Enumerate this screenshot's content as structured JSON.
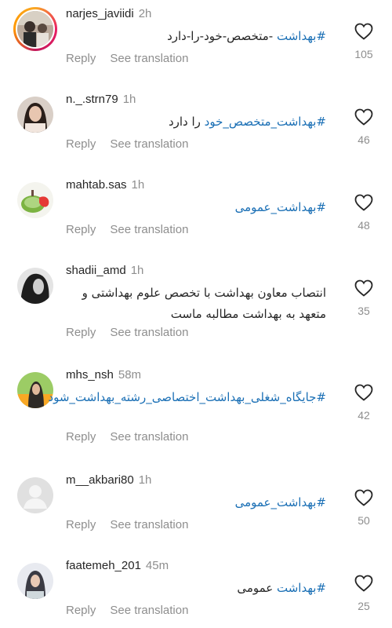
{
  "comments": [
    {
      "username": "narjes_javiidi",
      "time": "2h",
      "hashtag": "#بهداشت",
      "text": " -متخصص-خود-را-دارد",
      "reply": "Reply",
      "see_translation": "See translation",
      "likes": "105"
    },
    {
      "username": "n._.strn79",
      "time": "1h",
      "hashtag": "#بهداشت_متخصص_خود",
      "text": " را دارد",
      "reply": "Reply",
      "see_translation": "See translation",
      "likes": "46"
    },
    {
      "username": "mahtab.sas",
      "time": "1h",
      "hashtag": "#بهداشت_عمومی",
      "text": "",
      "reply": "Reply",
      "see_translation": "See translation",
      "likes": "48"
    },
    {
      "username": "shadii_amd",
      "time": "1h",
      "hashtag": "",
      "text": "انتصاب معاون بهداشت با تخصص علوم بهداشتی و متعهد به بهداشت مطالبه ماست",
      "reply": "Reply",
      "see_translation": "See translation",
      "likes": "35"
    },
    {
      "username": "mhs_nsh",
      "time": "58m",
      "hashtag": "#جایگاه_شغلی_بهداشت_اختصاصی_رشته_بهداشت_شود",
      "text": "",
      "reply": "Reply",
      "see_translation": "See translation",
      "likes": "42"
    },
    {
      "username": "m__akbari80",
      "time": "1h",
      "hashtag": "#بهداشت_عمومی",
      "text": "",
      "reply": "Reply",
      "see_translation": "See translation",
      "likes": "50"
    },
    {
      "username": "faatemeh_201",
      "time": "45m",
      "hashtag": "#بهداشت",
      "text": " عمومی",
      "reply": "Reply",
      "see_translation": "See translation",
      "likes": "25"
    }
  ],
  "icons": {
    "like": "heart-outline-icon"
  },
  "colors": {
    "hashtag": "#1a6fb5",
    "secondary_text": "#8e8e8e"
  }
}
